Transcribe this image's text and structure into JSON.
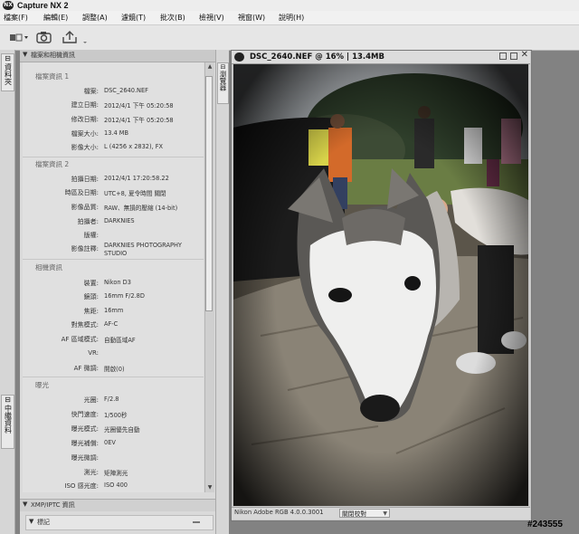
{
  "app": {
    "logo_text": "NX",
    "title": "Capture NX 2"
  },
  "menu": [
    {
      "label": "檔案",
      "key": "(F)"
    },
    {
      "label": "編輯",
      "key": "(E)"
    },
    {
      "label": "調整",
      "key": "(A)"
    },
    {
      "label": "濾鏡",
      "key": "(T)"
    },
    {
      "label": "批次",
      "key": "(B)"
    },
    {
      "label": "檢視",
      "key": "(V)"
    },
    {
      "label": "視窗",
      "key": "(W)"
    },
    {
      "label": "說明",
      "key": "(H)"
    }
  ],
  "side_tabs": {
    "browser": "資料夾",
    "metadata": "中繼資料"
  },
  "panel": {
    "header": "檔案和相機資訊",
    "right_tab": "瀏覽器",
    "sections": [
      {
        "title": "檔案資訊 1",
        "rows": [
          {
            "label": "檔案:",
            "value": "DSC_2640.NEF"
          },
          {
            "label": "建立日期:",
            "value": "2012/4/1 下午 05:20:58"
          },
          {
            "label": "修改日期:",
            "value": "2012/4/1 下午 05:20:58"
          },
          {
            "label": "檔案大小:",
            "value": "13.4 MB"
          },
          {
            "label": "影像大小:",
            "value": "L (4256 x 2832), FX"
          }
        ]
      },
      {
        "title": "檔案資訊 2",
        "rows": [
          {
            "label": "拍攝日期:",
            "value": "2012/4/1 17:20:58.22"
          },
          {
            "label": "時區及日期:",
            "value": "UTC+8, 夏令時間 關閉"
          },
          {
            "label": "影像品質:",
            "value": "RAW、無損的壓縮 (14-bit)"
          },
          {
            "label": "拍攝者:",
            "value": "DARKNIES"
          },
          {
            "label": "版權:",
            "value": ""
          },
          {
            "label": "影像註釋:",
            "value": "DARKNIES PHOTOGRAPHY STUDIO"
          }
        ]
      },
      {
        "title": "相機資訊",
        "rows": [
          {
            "label": "裝置:",
            "value": "Nikon D3"
          },
          {
            "label": "鏡頭:",
            "value": "16mm F/2.8D"
          },
          {
            "label": "焦距:",
            "value": "16mm"
          },
          {
            "label": "對焦模式:",
            "value": "AF-C"
          },
          {
            "label": "AF 區域模式:",
            "value": "自動區域AF"
          },
          {
            "label": "VR:",
            "value": ""
          },
          {
            "label": "AF 微調:",
            "value": "開啟(0)"
          }
        ]
      },
      {
        "title": "曝光",
        "rows": [
          {
            "label": "光圈:",
            "value": "F/2.8"
          },
          {
            "label": "快門速度:",
            "value": "1/500秒"
          },
          {
            "label": "曝光模式:",
            "value": "光圈優先自動"
          },
          {
            "label": "曝光補償:",
            "value": "0EV"
          },
          {
            "label": "曝光微調:",
            "value": ""
          },
          {
            "label": "測光:",
            "value": "矩陣測光"
          },
          {
            "label": "ISO 感光度:",
            "value": "ISO 400"
          }
        ]
      }
    ],
    "xmp_header": "XMP/IPTC 資訊",
    "sub_header": "標記"
  },
  "image_window": {
    "title": "DSC_2640.NEF @ 16% | 13.4MB",
    "status_profile": "Nikon Adobe RGB 4.0.0.3001",
    "status_dropdown": "關閉校對"
  },
  "watermark": "#243555",
  "colors": {
    "chrome": "#e6e6e6",
    "panel": "#e0e0e0",
    "workspace": "#828282"
  }
}
